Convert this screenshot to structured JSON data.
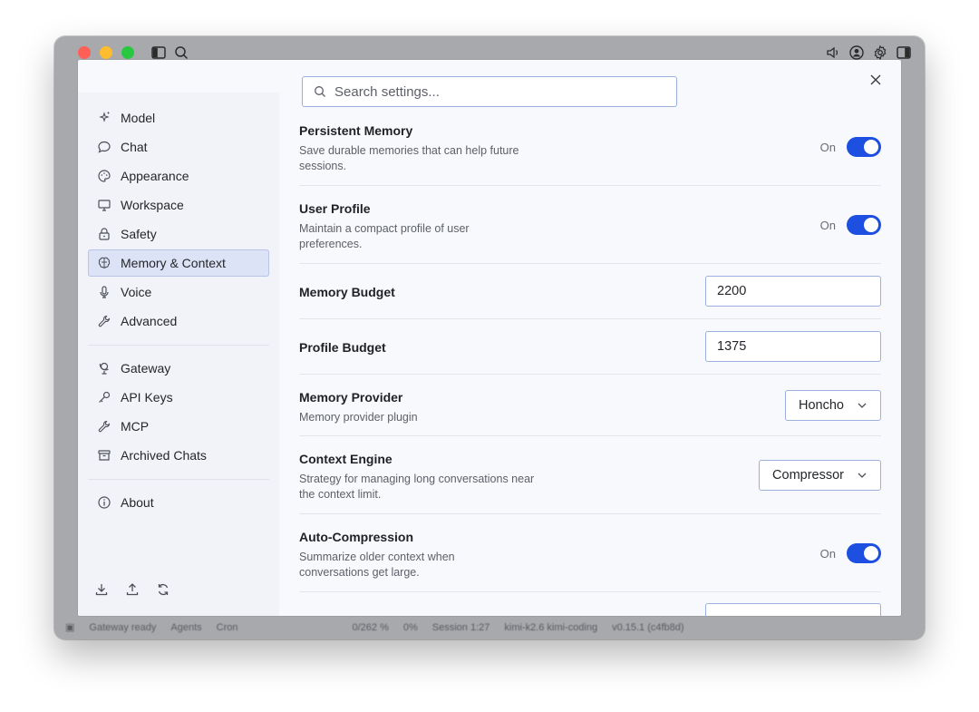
{
  "window": {
    "statusbar": {
      "gateway": "Gateway ready",
      "agents": "Agents",
      "cron": "Cron",
      "usage": "0/262 %",
      "percent": "0%",
      "session": "Session 1:27",
      "model": "kimi-k2.6 kimi-coding",
      "version": "v0.15.1 (c4fb8d)"
    }
  },
  "search": {
    "placeholder": "Search settings..."
  },
  "sidebar": {
    "items": [
      {
        "label": "Model",
        "icon": "sparkles-icon"
      },
      {
        "label": "Chat",
        "icon": "chat-bubble-icon"
      },
      {
        "label": "Appearance",
        "icon": "palette-icon"
      },
      {
        "label": "Workspace",
        "icon": "monitor-icon"
      },
      {
        "label": "Safety",
        "icon": "lock-icon"
      },
      {
        "label": "Memory & Context",
        "icon": "brain-icon",
        "active": true
      },
      {
        "label": "Voice",
        "icon": "microphone-icon"
      },
      {
        "label": "Advanced",
        "icon": "wrench-icon"
      },
      {
        "label": "Gateway",
        "icon": "globe-stand-icon"
      },
      {
        "label": "API Keys",
        "icon": "key-icon"
      },
      {
        "label": "MCP",
        "icon": "plug-icon"
      },
      {
        "label": "Archived Chats",
        "icon": "archive-icon"
      },
      {
        "label": "About",
        "icon": "info-icon"
      }
    ]
  },
  "settings": {
    "persistent_memory": {
      "title": "Persistent Memory",
      "desc": "Save durable memories that can help future sessions.",
      "state": "On"
    },
    "user_profile": {
      "title": "User Profile",
      "desc": "Maintain a compact profile of user preferences.",
      "state": "On"
    },
    "memory_budget": {
      "title": "Memory Budget",
      "value": "2200"
    },
    "profile_budget": {
      "title": "Profile Budget",
      "value": "1375"
    },
    "memory_provider": {
      "title": "Memory Provider",
      "desc": "Memory provider plugin",
      "value": "Honcho"
    },
    "context_engine": {
      "title": "Context Engine",
      "desc": "Strategy for managing long conversations near the context limit.",
      "value": "Compressor"
    },
    "auto_compression": {
      "title": "Auto-Compression",
      "desc": "Summarize older context when conversations get large.",
      "state": "On"
    }
  },
  "colors": {
    "accent": "#1d4fe0",
    "active_nav": "#dce3f6",
    "close_red": "#fe5f57",
    "minimize_yellow": "#febc2e",
    "zoom_green": "#28c840"
  }
}
